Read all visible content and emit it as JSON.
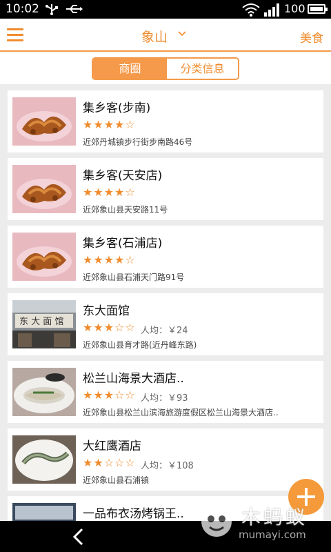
{
  "status_bar": {
    "time": "10:02",
    "battery": "100"
  },
  "header": {
    "city": "象山",
    "category": "美食"
  },
  "tabs": [
    {
      "label": "商圈",
      "active": true
    },
    {
      "label": "分类信息",
      "active": false
    }
  ],
  "colors": {
    "accent": "#f08c2e",
    "fab": "#f59a3a"
  },
  "restaurants": [
    {
      "name": "集乡客(步南)",
      "stars": "★★★★☆",
      "rating": 4,
      "price": "",
      "address": "近郊丹城镇步行街步南路46号",
      "image": "food-photo"
    },
    {
      "name": "集乡客(天安店)",
      "stars": "★★★★☆",
      "rating": 4,
      "price": "",
      "address": "近郊象山县天安路11号",
      "image": "food-photo"
    },
    {
      "name": "集乡客(石浦店)",
      "stars": "★★★★☆",
      "rating": 4,
      "price": "",
      "address": "近郊象山县石浦天门路91号",
      "image": "food-photo"
    },
    {
      "name": "东大面馆",
      "stars": "★★★☆☆",
      "rating": 3,
      "price": "人均：￥24",
      "address": "近郊象山县育才路(近丹峰东路)",
      "image": "storefront-photo"
    },
    {
      "name": "松兰山海景大酒店..",
      "stars": "★★★☆☆",
      "rating": 3,
      "price": "人均：￥93",
      "address": "近郊象山县松兰山滨海旅游度假区松兰山海景大酒店..",
      "image": "fish-dish-photo"
    },
    {
      "name": "大红鹰酒店",
      "stars": "★★☆☆☆",
      "rating": 2,
      "price": "人均：￥108",
      "address": "近郊象山县石浦镇",
      "image": "plate-photo"
    },
    {
      "name": "一品布衣汤烤锅王..",
      "stars": "",
      "rating": 0,
      "price": "",
      "address": "",
      "image": "shop-photo"
    }
  ],
  "watermark": {
    "text": "木蚂蚁",
    "url": "mumayi.com"
  }
}
